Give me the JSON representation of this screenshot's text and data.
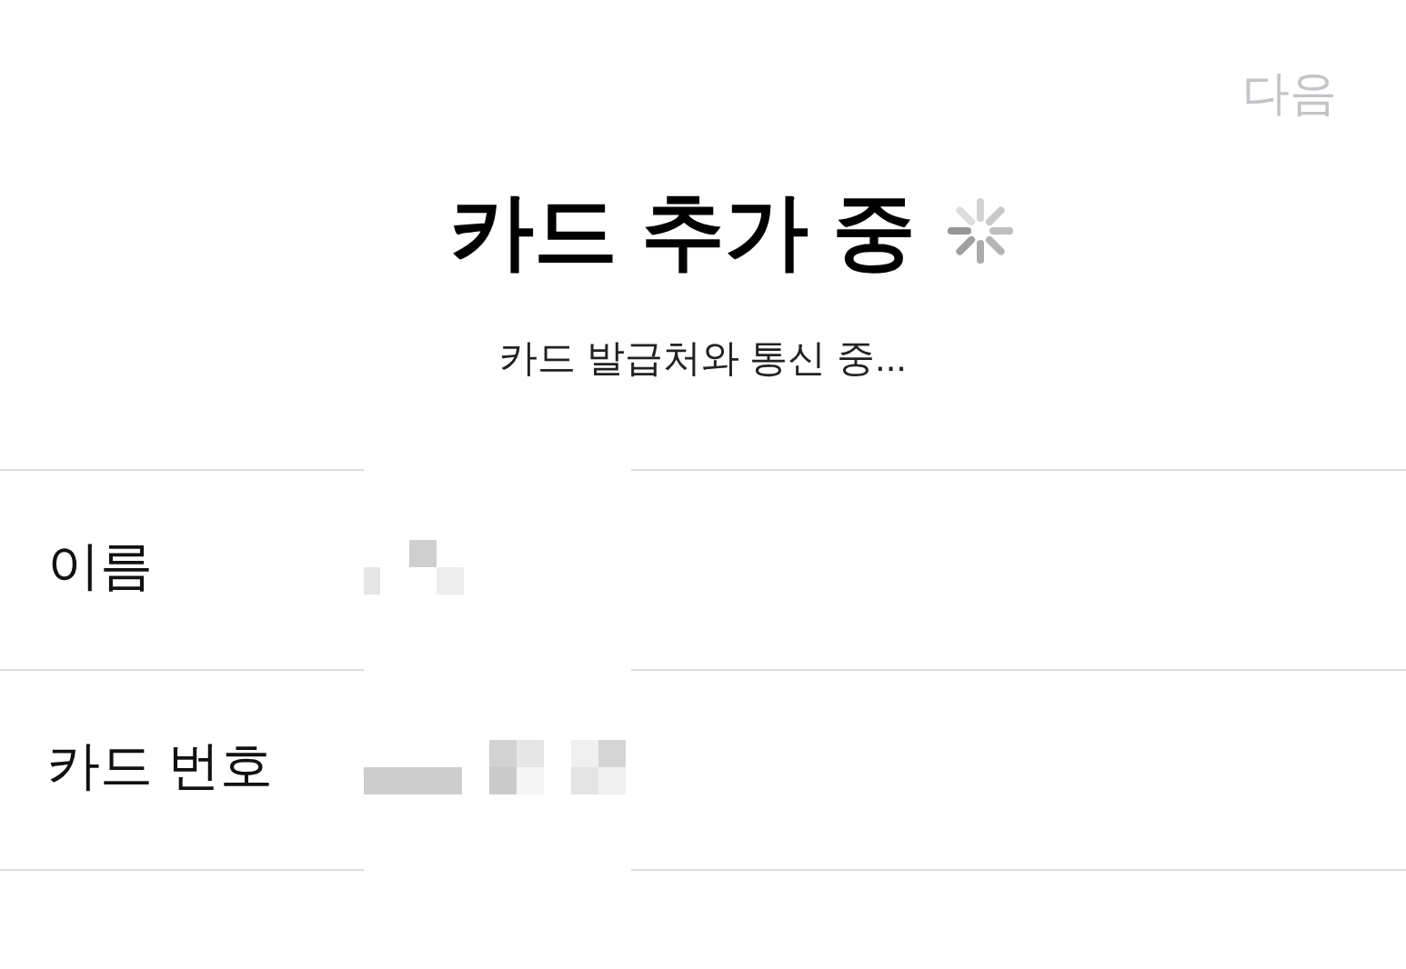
{
  "header": {
    "next_button": {
      "label": "다음",
      "disabled": true
    }
  },
  "title": "카드 추가 중",
  "loading": true,
  "subtitle": "카드 발급처와 통신 중...",
  "fields": [
    {
      "label": "이름",
      "kind": "name"
    },
    {
      "label": "카드 번호",
      "kind": "number"
    }
  ]
}
